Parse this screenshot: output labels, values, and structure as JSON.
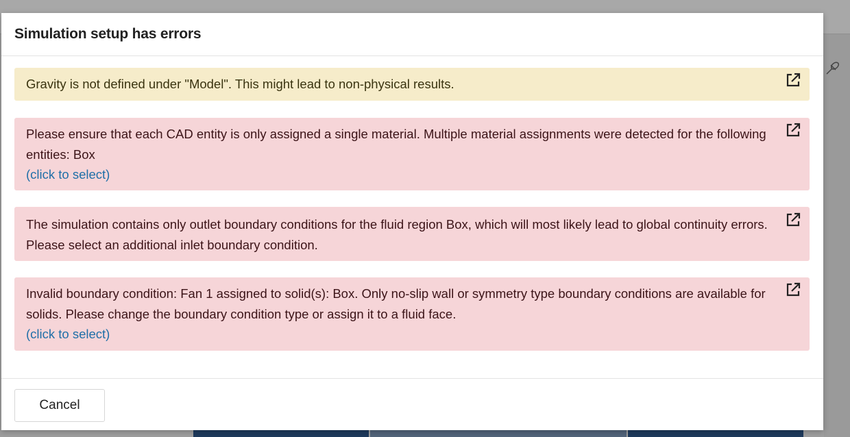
{
  "dialog": {
    "title": "Simulation setup has errors"
  },
  "alerts": [
    {
      "type": "warning",
      "text": "Gravity is not defined under \"Model\". This might lead to non-physical results.",
      "icon": "external-link-icon"
    },
    {
      "type": "error",
      "text": "Please ensure that each CAD entity is only assigned a single material. Multiple material assignments were detected for the following entities: Box",
      "link": "(click to select)",
      "icon": "external-link-icon"
    },
    {
      "type": "error",
      "text": "The simulation contains only outlet boundary conditions for the fluid region Box, which will most likely lead to global continuity errors. Please select an additional inlet boundary condition.",
      "icon": "external-link-icon"
    },
    {
      "type": "error",
      "text": "Invalid boundary condition: Fan 1 assigned to solid(s): Box. Only no-slip wall or symmetry type boundary conditions are available for solids. Please change the boundary condition type or assign it to a fluid face.",
      "link": "(click to select)",
      "icon": "external-link-icon"
    }
  ],
  "footer": {
    "cancel_label": "Cancel"
  },
  "colors": {
    "warning_bg": "#f6ecca",
    "error_bg": "#f6d5d8",
    "link": "#1f6fa8"
  }
}
